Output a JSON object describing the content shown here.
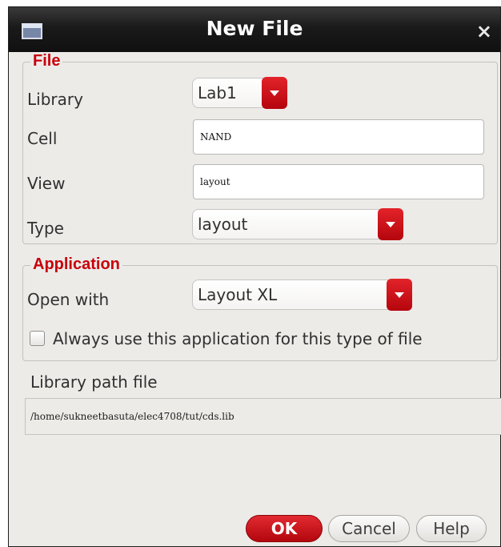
{
  "window": {
    "title": "New File",
    "close_glyph": "×",
    "title_icon": "window-icon"
  },
  "file_group": {
    "legend": "File",
    "library": {
      "label": "Library",
      "value": "Lab1"
    },
    "cell": {
      "label": "Cell",
      "value": "NAND"
    },
    "view": {
      "label": "View",
      "value": "layout"
    },
    "type": {
      "label": "Type",
      "value": "layout"
    }
  },
  "application_group": {
    "legend": "Application",
    "open_with": {
      "label": "Open with",
      "value": "Layout XL"
    },
    "always_use": {
      "label": "Always use this application for this type of file",
      "checked": false
    }
  },
  "library_path": {
    "label": "Library path file",
    "value": "/home/sukneetbasuta/elec4708/tut/cds.lib"
  },
  "buttons": {
    "ok": "OK",
    "cancel": "Cancel",
    "help": "Help"
  },
  "colors": {
    "accent_red": "#c8000a",
    "titlebar": "#1a1a1a",
    "dialog_bg": "#ecebe8"
  }
}
